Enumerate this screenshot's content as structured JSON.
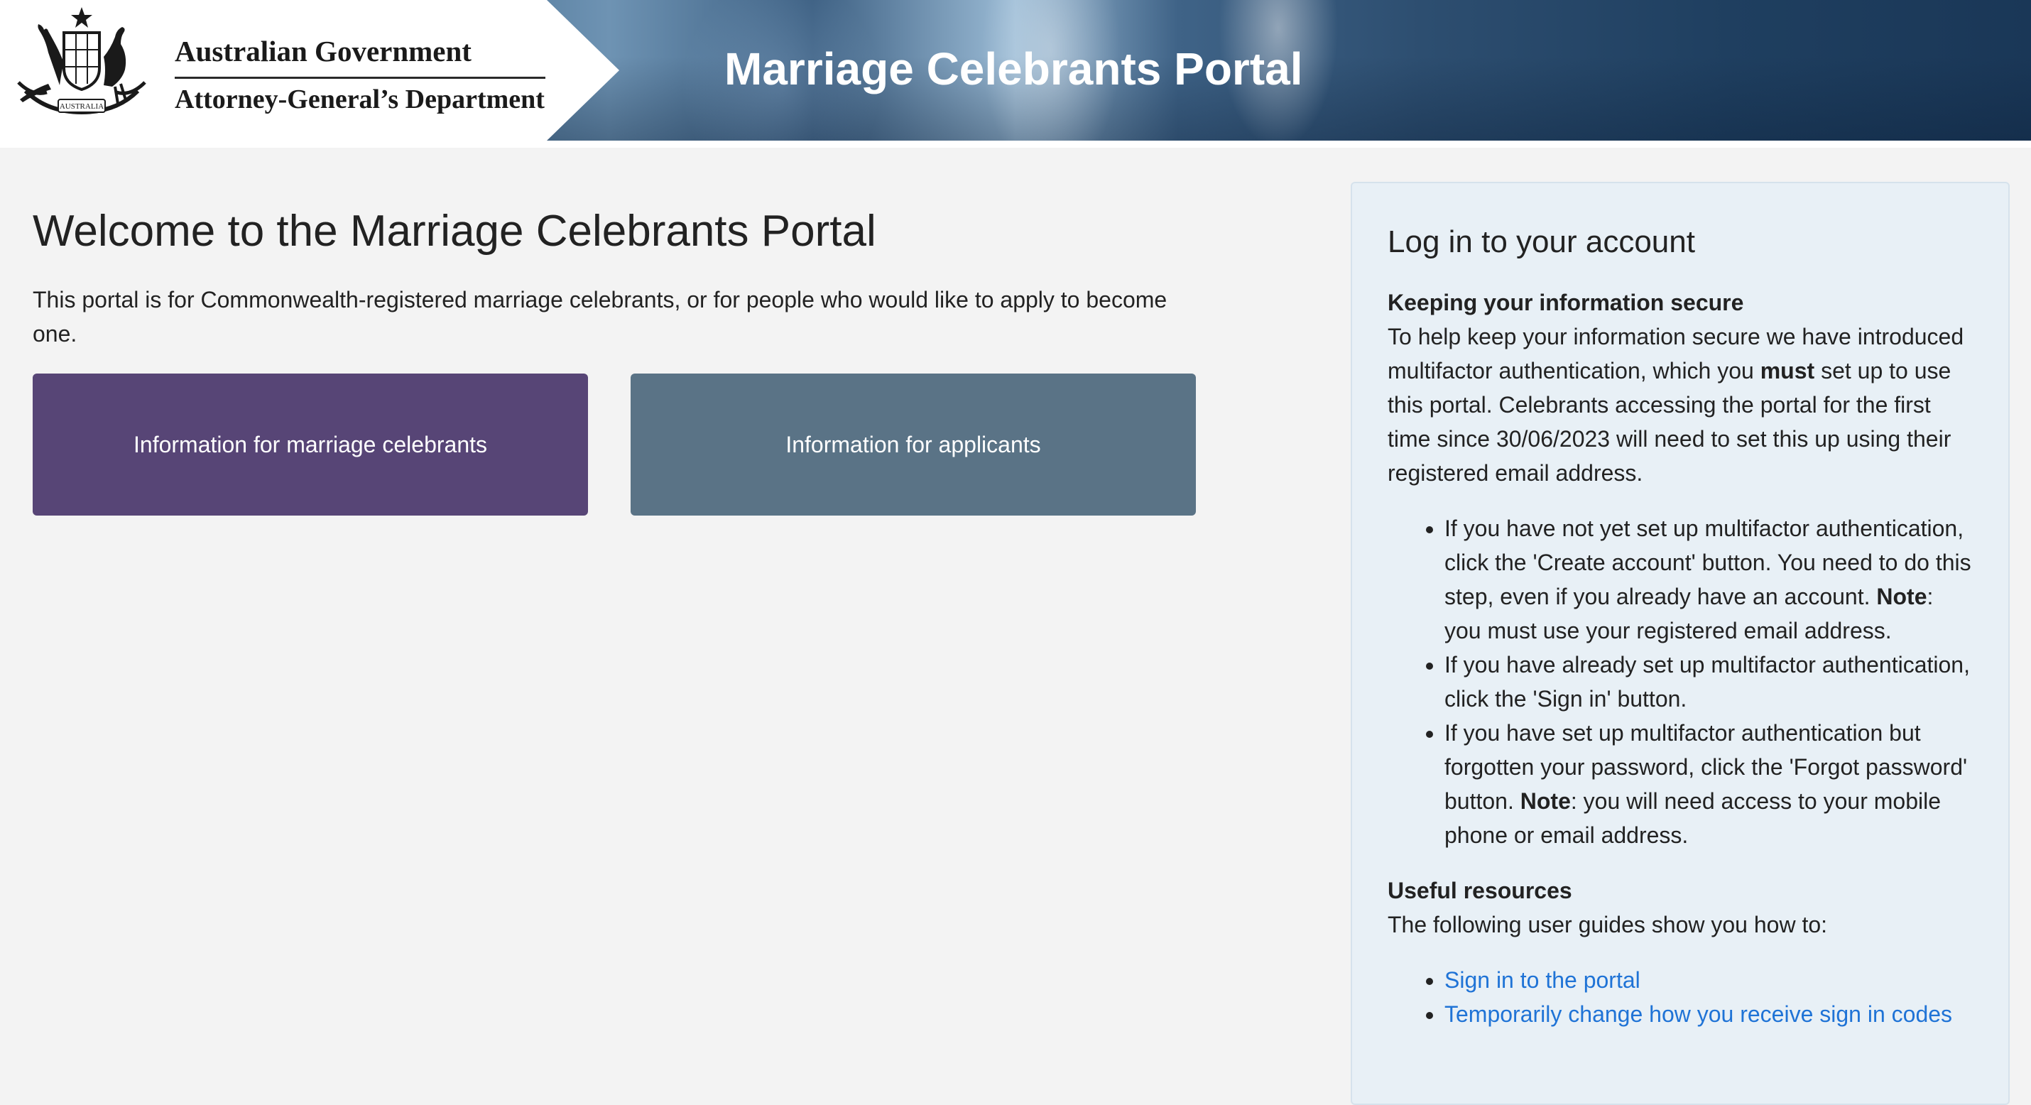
{
  "header": {
    "gov_name": "Australian Government",
    "department": "Attorney-General’s Department",
    "crest_text": "AUSTRALIA",
    "portal_title": "Marriage Celebrants Portal"
  },
  "main": {
    "heading": "Welcome to the Marriage Celebrants Portal",
    "intro": "This portal is for Commonwealth-registered marriage celebrants, or for people who would like to apply to become one.",
    "tiles": [
      {
        "label": "Information for marriage celebrants",
        "color": "#574576"
      },
      {
        "label": "Information for applicants",
        "color": "#5a7386"
      }
    ]
  },
  "login": {
    "title": "Log in to your account",
    "secure_heading": "Keeping your information secure",
    "secure_p_part1": "To help keep your information secure we have introduced multifactor authentication, which you ",
    "secure_p_must": "must",
    "secure_p_part2": " set up to use this portal. Celebrants accessing the portal for the first time since 30/06/2023 will need to set this up using their registered email address.",
    "bullets": [
      {
        "text": "If you have not yet set up multifactor authentication, click the 'Create account' button. You need to do this step, even if you already have an account. ",
        "note_label": "Note",
        "note_text": ": you must use your registered email address."
      },
      {
        "text": "If you have already set up multifactor authentication, click the 'Sign in' button."
      },
      {
        "text": "If you have set up multifactor authentication but forgotten your password, click the 'Forgot password' button. ",
        "note_label": "Note",
        "note_text": ": you will need access to your mobile phone or email address."
      }
    ],
    "resources_heading": "Useful resources",
    "resources_intro": "The following user guides show you how to:",
    "resources": [
      {
        "label": "Sign in to the portal"
      },
      {
        "label": "Temporarily change how you receive sign in codes"
      }
    ],
    "link_color": "#1f73d6"
  }
}
